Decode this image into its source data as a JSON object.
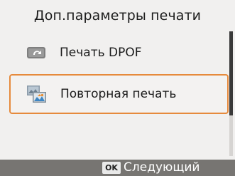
{
  "screen": {
    "title": "Доп.параметры печати"
  },
  "menu": {
    "items": [
      {
        "label": "Печать DPOF",
        "icon": "dpof-print-icon",
        "selected": false
      },
      {
        "label": "Повторная печать",
        "icon": "reprint-photos-icon",
        "selected": true
      }
    ]
  },
  "footer": {
    "ok_label": "OK",
    "next_label": "Следующий"
  },
  "colors": {
    "background": "#f1f0ef",
    "selection_border": "#e68a3c",
    "footer_bar": "#777572"
  }
}
